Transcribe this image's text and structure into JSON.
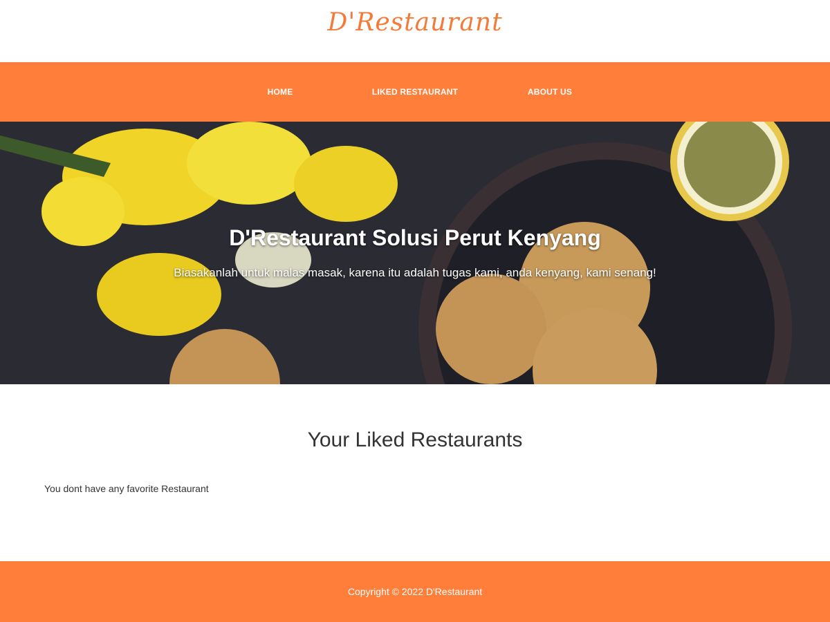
{
  "header": {
    "logo_text": "D'Restaurant"
  },
  "nav": {
    "items": [
      {
        "label": "HOME"
      },
      {
        "label": "LIKED RESTAURANT"
      },
      {
        "label": "ABOUT US"
      }
    ]
  },
  "hero": {
    "title": "D'Restaurant Solusi Perut Kenyang",
    "subtitle": "Biasakanlah untuk malas masak, karena itu adalah tugas kami, anda kenyang, kami senang!"
  },
  "main": {
    "title": "Your Liked Restaurants",
    "empty_message": "You dont have any favorite Restaurant"
  },
  "footer": {
    "copyright": "Copyright © 2022 D'Restaurant"
  },
  "colors": {
    "accent": "#FF7F3A",
    "logo": "#F47A3A",
    "hero_bg": "#2b2c33"
  }
}
